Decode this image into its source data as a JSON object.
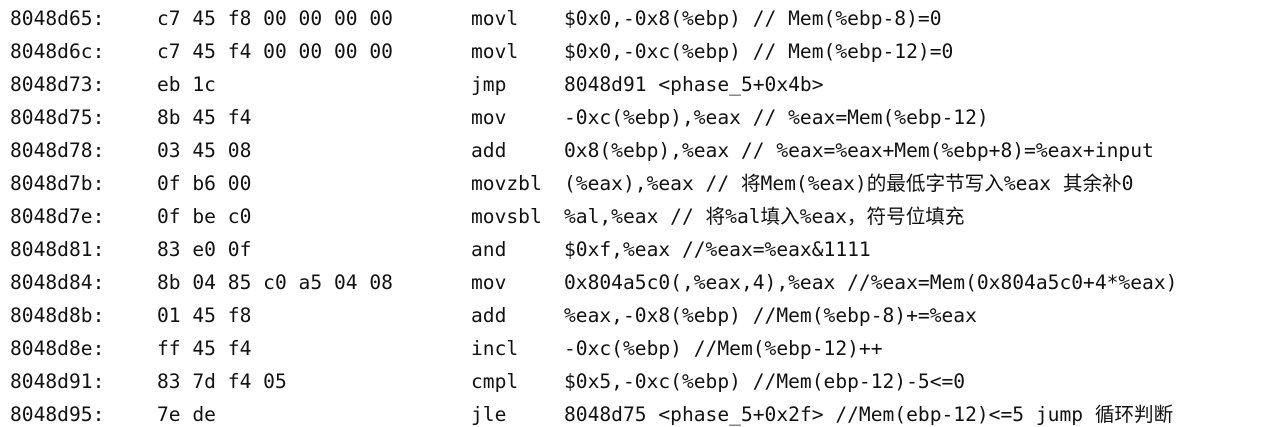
{
  "disassembly": {
    "rows": [
      {
        "address": "8048d65:",
        "bytes": "c7 45 f8 00 00 00 00",
        "mnemonic": "movl",
        "operands": "$0x0,-0x8(%ebp) // Mem(%ebp-8)=0"
      },
      {
        "address": "8048d6c:",
        "bytes": "c7 45 f4 00 00 00 00",
        "mnemonic": "movl",
        "operands": "$0x0,-0xc(%ebp) // Mem(%ebp-12)=0"
      },
      {
        "address": "8048d73:",
        "bytes": "eb 1c",
        "mnemonic": "jmp",
        "operands": "8048d91 <phase_5+0x4b>"
      },
      {
        "address": "8048d75:",
        "bytes": "8b 45 f4",
        "mnemonic": "mov",
        "operands": "-0xc(%ebp),%eax // %eax=Mem(%ebp-12)"
      },
      {
        "address": "8048d78:",
        "bytes": "03 45 08",
        "mnemonic": "add",
        "operands": "0x8(%ebp),%eax // %eax=%eax+Mem(%ebp+8)=%eax+input"
      },
      {
        "address": "8048d7b:",
        "bytes": "0f b6 00",
        "mnemonic": "movzbl",
        "operands": "(%eax),%eax // 将Mem(%eax)的最低字节写入%eax 其余补0"
      },
      {
        "address": "8048d7e:",
        "bytes": "0f be c0",
        "mnemonic": "movsbl",
        "operands": "%al,%eax // 将%al填入%eax，符号位填充"
      },
      {
        "address": "8048d81:",
        "bytes": "83 e0 0f",
        "mnemonic": "and",
        "operands": "$0xf,%eax //%eax=%eax&1111"
      },
      {
        "address": "8048d84:",
        "bytes": "8b 04 85 c0 a5 04 08",
        "mnemonic": "mov",
        "operands": "0x804a5c0(,%eax,4),%eax //%eax=Mem(0x804a5c0+4*%eax)"
      },
      {
        "address": "8048d8b:",
        "bytes": "01 45 f8",
        "mnemonic": "add",
        "operands": "%eax,-0x8(%ebp) //Mem(%ebp-8)+=%eax"
      },
      {
        "address": "8048d8e:",
        "bytes": "ff 45 f4",
        "mnemonic": "incl",
        "operands": "-0xc(%ebp) //Mem(%ebp-12)++"
      },
      {
        "address": "8048d91:",
        "bytes": "83 7d f4 05",
        "mnemonic": "cmpl",
        "operands": "$0x5,-0xc(%ebp) //Mem(ebp-12)-5<=0"
      },
      {
        "address": "8048d95:",
        "bytes": "7e de",
        "mnemonic": "jle",
        "operands": "8048d75 <phase_5+0x2f> //Mem(ebp-12)<=5 jump 循环判断"
      }
    ]
  }
}
